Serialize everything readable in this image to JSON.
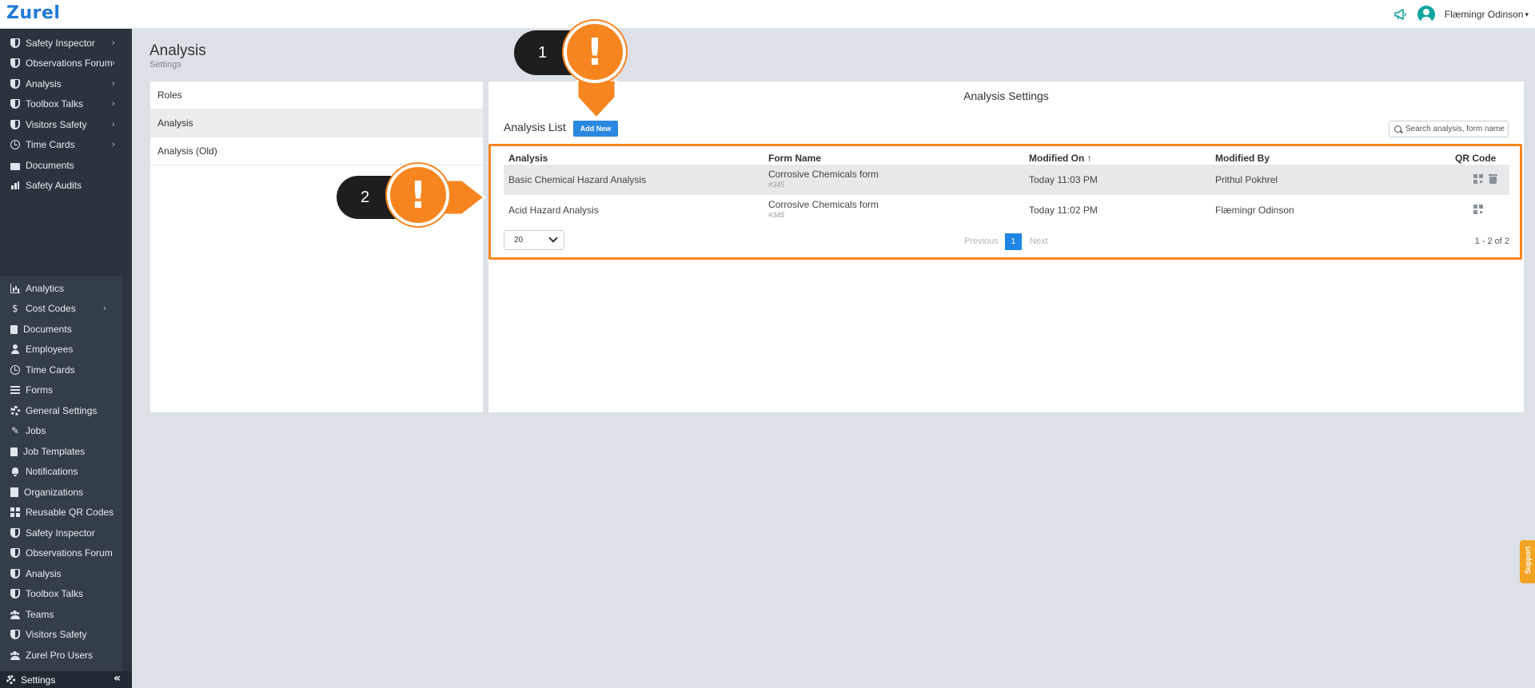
{
  "app": {
    "logo": "Zurel"
  },
  "header": {
    "username": "Flæmingr Odinson",
    "caret": "▾"
  },
  "sidebar": {
    "top_items": [
      {
        "label": "Safety Inspector"
      },
      {
        "label": "Observations Forum"
      },
      {
        "label": "Analysis"
      },
      {
        "label": "Toolbox Talks"
      },
      {
        "label": "Visitors Safety"
      },
      {
        "label": "Time Cards"
      },
      {
        "label": "Documents"
      },
      {
        "label": "Safety Audits"
      }
    ],
    "bottom_items": [
      {
        "label": "Analytics"
      },
      {
        "label": "Cost Codes"
      },
      {
        "label": "Documents"
      },
      {
        "label": "Employees"
      },
      {
        "label": "Time Cards"
      },
      {
        "label": "Forms"
      },
      {
        "label": "General Settings"
      },
      {
        "label": "Jobs"
      },
      {
        "label": "Job Templates"
      },
      {
        "label": "Notifications"
      },
      {
        "label": "Organizations"
      },
      {
        "label": "Reusable QR Codes"
      },
      {
        "label": "Safety Inspector"
      },
      {
        "label": "Observations Forum"
      },
      {
        "label": "Analysis"
      },
      {
        "label": "Toolbox Talks"
      },
      {
        "label": "Teams"
      },
      {
        "label": "Visitors Safety"
      },
      {
        "label": "Zurel Pro Users"
      }
    ],
    "settings_label": "Settings",
    "collapse_glyph": "«",
    "dollar_glyph": "$",
    "wrench_glyph": "✎",
    "chevron": "›"
  },
  "page": {
    "title": "Analysis",
    "subtitle": "Settings"
  },
  "left_panel": {
    "items": [
      {
        "label": "Roles"
      },
      {
        "label": "Analysis"
      },
      {
        "label": "Analysis (Old)"
      }
    ]
  },
  "right_panel": {
    "title": "Analysis Settings",
    "list_title": "Analysis List",
    "add_new_label": "Add New",
    "search_placeholder": "Search analysis, form name",
    "columns": {
      "analysis": "Analysis",
      "form_name": "Form Name",
      "modified_on": "Modified On",
      "sort_indicator": "↑",
      "modified_by": "Modified By",
      "qr_code": "QR Code"
    },
    "rows": [
      {
        "analysis": "Basic Chemical Hazard Analysis",
        "form_name": "Corrosive Chemicals form",
        "form_id": "#345",
        "modified_on": "Today 11:03 PM",
        "modified_by": "Prithul Pokhrel"
      },
      {
        "analysis": "Acid Hazard Analysis",
        "form_name": "Corrosive Chemicals form",
        "form_id": "#345",
        "modified_on": "Today 11:02 PM",
        "modified_by": "Flæmingr Odinson"
      }
    ],
    "pagination": {
      "page_size": "20",
      "previous": "Previous",
      "current_page": "1",
      "next": "Next",
      "count": "1 - 2 of 2"
    }
  },
  "callouts": [
    {
      "number": "1",
      "glyph": "!"
    },
    {
      "number": "2",
      "glyph": "!"
    }
  ],
  "support": {
    "label": "Support"
  },
  "colors": {
    "accent": "#2a88e0",
    "callout_orange": "#f7851f",
    "sidebar_bg": "#2b343e",
    "page_bg": "#dce1e7"
  }
}
